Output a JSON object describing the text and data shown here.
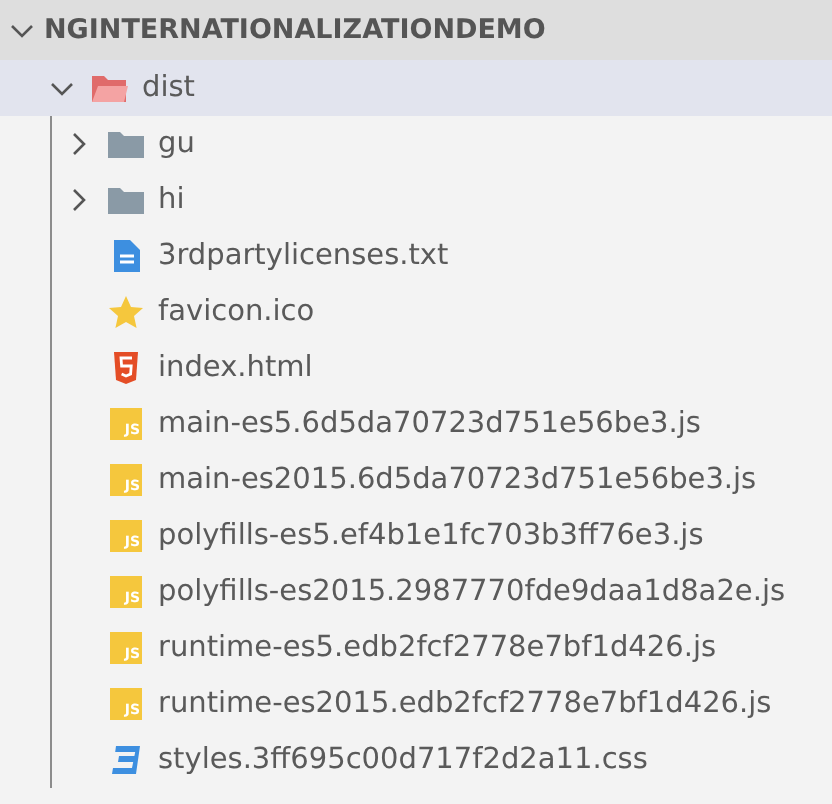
{
  "explorer": {
    "root": {
      "label": "NGINTERNATIONALIZATIONDEMO",
      "expanded": true
    },
    "tree": [
      {
        "label": "dist",
        "kind": "folder",
        "expanded": true,
        "selected": true,
        "children": [
          {
            "label": "gu",
            "kind": "folder",
            "expanded": false,
            "selected": false
          },
          {
            "label": "hi",
            "kind": "folder",
            "expanded": false,
            "selected": false
          },
          {
            "label": "3rdpartylicenses.txt",
            "kind": "text",
            "selected": false
          },
          {
            "label": "favicon.ico",
            "kind": "favicon",
            "selected": false
          },
          {
            "label": "index.html",
            "kind": "html",
            "selected": false
          },
          {
            "label": "main-es5.6d5da70723d751e56be3.js",
            "kind": "js",
            "icon_label": "JS",
            "selected": false
          },
          {
            "label": "main-es2015.6d5da70723d751e56be3.js",
            "kind": "js",
            "icon_label": "JS",
            "selected": false
          },
          {
            "label": "polyfills-es5.ef4b1e1fc703b3ff76e3.js",
            "kind": "js",
            "icon_label": "JS",
            "selected": false
          },
          {
            "label": "polyfills-es2015.2987770fde9daa1d8a2e.js",
            "kind": "js",
            "icon_label": "JS",
            "selected": false
          },
          {
            "label": "runtime-es5.edb2fcf2778e7bf1d426.js",
            "kind": "js",
            "icon_label": "JS",
            "selected": false
          },
          {
            "label": "runtime-es2015.edb2fcf2778e7bf1d426.js",
            "kind": "js",
            "icon_label": "JS",
            "selected": false
          },
          {
            "label": "styles.3ff695c00d717f2d2a11.css",
            "kind": "css",
            "selected": false
          }
        ]
      }
    ]
  }
}
